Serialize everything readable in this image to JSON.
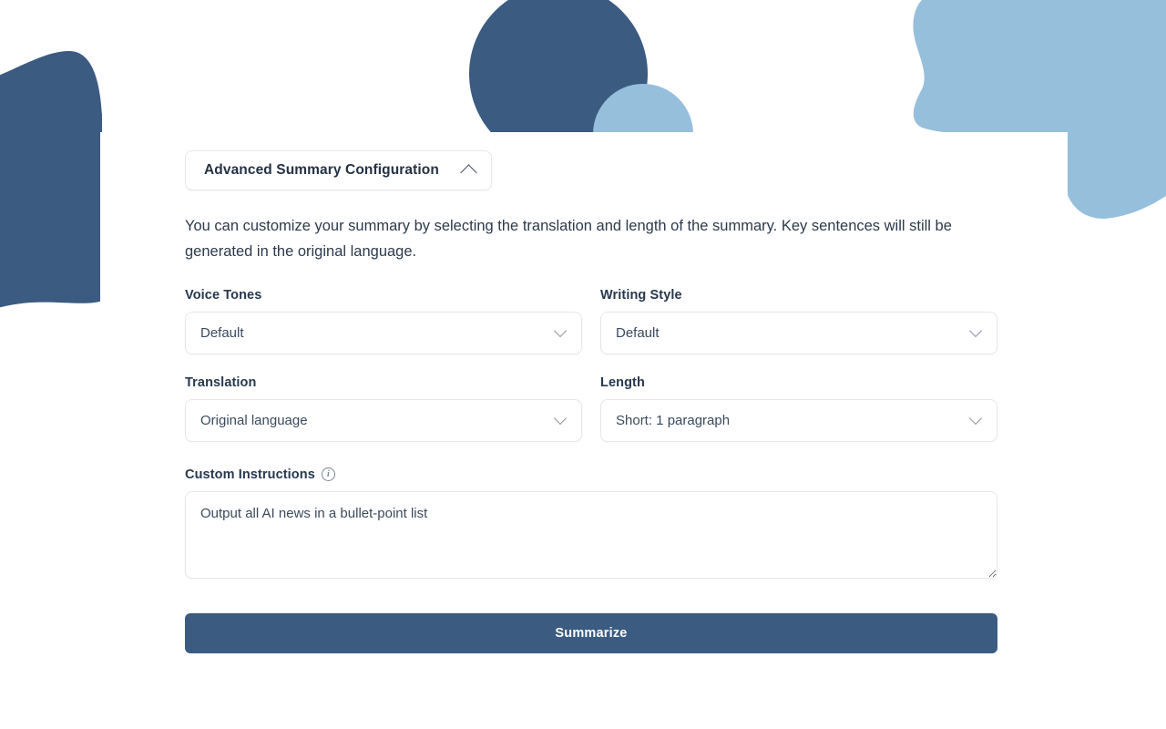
{
  "theme": {
    "accent_dark_blue": "#3b5b81",
    "accent_light_blue": "#96bfdc",
    "card_background": "#ffffff",
    "button_background": "#3b5b81",
    "button_text": "#ffffff"
  },
  "panel": {
    "toggle_label": "Advanced Summary Configuration",
    "toggle_icon": "chevron-up-icon",
    "description": "You can customize your summary by selecting the translation and length of the summary. Key sentences will still be generated in the original language."
  },
  "fields": {
    "voice_tones": {
      "label": "Voice Tones",
      "value": "Default"
    },
    "writing_style": {
      "label": "Writing Style",
      "value": "Default"
    },
    "translation": {
      "label": "Translation",
      "value": "Original language"
    },
    "length": {
      "label": "Length",
      "value": "Short: 1 paragraph"
    },
    "custom_instructions": {
      "label": "Custom Instructions",
      "info_icon": "info-icon",
      "value": "Output all AI news in a bullet-point list",
      "placeholder": ""
    }
  },
  "actions": {
    "summarize_label": "Summarize"
  }
}
